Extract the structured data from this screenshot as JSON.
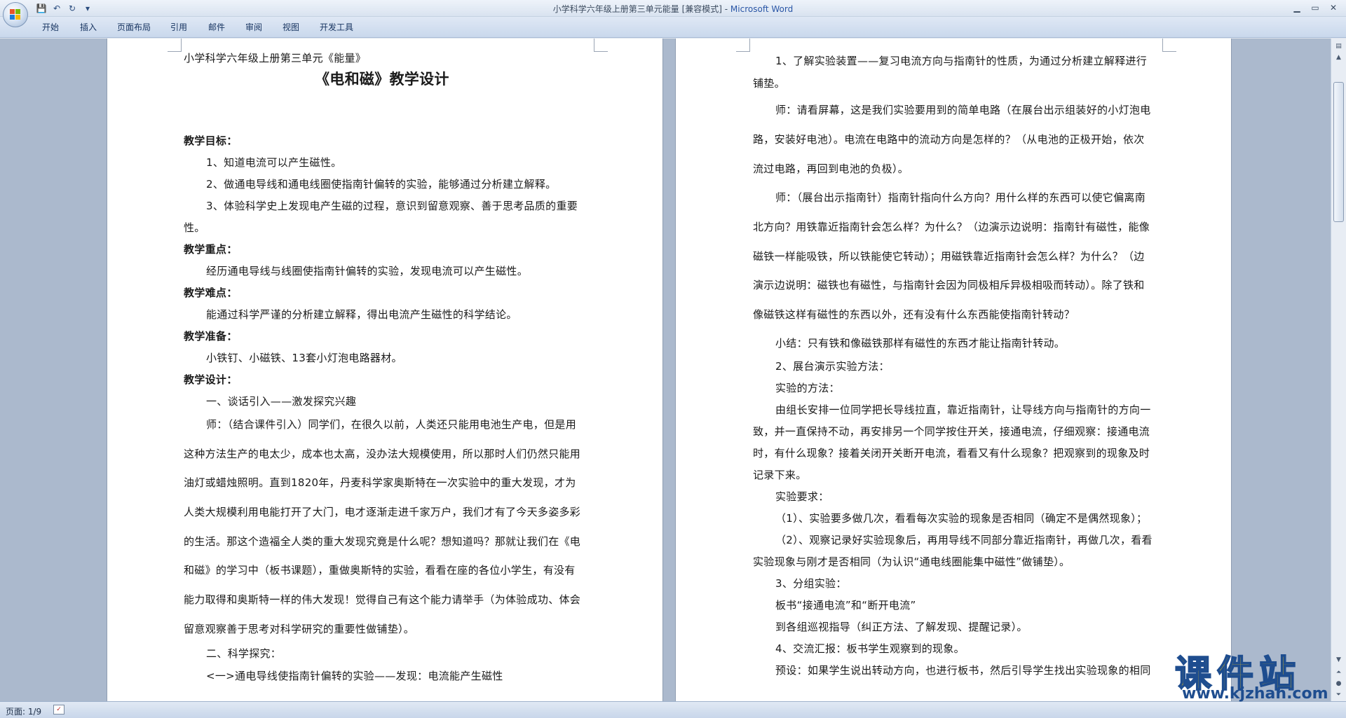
{
  "window": {
    "title": "小学科学六年级上册第三单元能量 [兼容模式] - ",
    "app_name": "Microsoft Word",
    "controls": [
      "▁",
      "▭",
      "✕"
    ]
  },
  "quick_access": {
    "save_icon": "floppy-disk-icon",
    "undo_icon": "undo-icon",
    "redo_icon": "redo-icon",
    "customize_icon": "customize-arrow-icon"
  },
  "ribbon": {
    "tabs": [
      "开始",
      "插入",
      "页面布局",
      "引用",
      "邮件",
      "审阅",
      "视图",
      "开发工具"
    ]
  },
  "left_page": {
    "lines": [
      "小学科学六年级上册第三单元《能量》",
      "《电和磁》教学设计",
      "",
      "",
      "教学目标：",
      "1、知道电流可以产生磁性。",
      "2、做通电导线和通电线圈使指南针偏转的实验，能够通过分析建立解释。",
      "3、体验科学史上发现电产生磁的过程，意识到留意观察、善于思考品质的重要",
      "性。",
      "教学重点：",
      "经历通电导线与线圈使指南针偏转的实验，发现电流可以产生磁性。",
      "教学难点：",
      "能通过科学严谨的分析建立解释，得出电流产生磁性的科学结论。",
      "教学准备：",
      "小铁钉、小磁铁、13套小灯泡电路器材。",
      "教学设计：",
      "一、谈话引入——激发探究兴趣",
      "师：（结合课件引入）同学们，在很久以前，人类还只能用电池生产电，但是用",
      "这种方法生产的电太少，成本也太高，没办法大规模使用，所以那时人们仍然只能用",
      "油灯或蜡烛照明。直到1820年，丹麦科学家奥斯特在一次实验中的重大发现，才为",
      "人类大规模利用电能打开了大门，电才逐渐走进千家万户，我们才有了今天多姿多彩",
      "的生活。那这个造福全人类的重大发现究竟是什么呢？想知道吗？那就让我们在《电",
      "和磁》的学习中（板书课题），重做奥斯特的实验，看看在座的各位小学生，有没有",
      "能力取得和奥斯特一样的伟大发现！觉得自己有这个能力请举手（为体验成功、体会",
      "留意观察善于思考对科学研究的重要性做铺垫）。",
      "二、科学探究：",
      "<一>通电导线使指南针偏转的实验——发现：电流能产生磁性"
    ]
  },
  "right_page": {
    "lines": [
      "1、了解实验装置——复习电流方向与指南针的性质，为通过分析建立解释进行",
      "铺垫。",
      "师：请看屏幕，这是我们实验要用到的简单电路（在展台出示组装好的小灯泡电",
      "路，安装好电池）。电流在电路中的流动方向是怎样的？（从电池的正极开始，依次",
      "流过电路，再回到电池的负极）。",
      "师：（展台出示指南针）指南针指向什么方向？用什么样的东西可以使它偏离南",
      "北方向？用铁靠近指南针会怎么样？为什么？（边演示边说明：指南针有磁性，能像",
      "磁铁一样能吸铁，所以铁能使它转动）；用磁铁靠近指南针会怎么样？为什么？（边",
      "演示边说明：磁铁也有磁性，与指南针会因为同极相斥异极相吸而转动）。除了铁和",
      "像磁铁这样有磁性的东西以外，还有没有什么东西能使指南针转动？",
      "小结：只有铁和像磁铁那样有磁性的东西才能让指南针转动。",
      "2、展台演示实验方法：",
      "实验的方法：",
      "由组长安排一位同学把长导线拉直，靠近指南针，让导线方向与指南针的方向一",
      "致，并一直保持不动，再安排另一个同学按住开关，接通电流，仔细观察：接通电流",
      "时，有什么现象？接着关闭开关断开电流，看看又有什么现象？把观察到的现象及时",
      "记录下来。",
      "实验要求：",
      "（1）、实验要多做几次，看看每次实验的现象是否相同（确定不是偶然现象）；",
      "（2）、观察记录好实验现象后，再用导线不同部分靠近指南针，再做几次，看看",
      "实验现象与刚才是否相同（为认识“通电线圈能集中磁性”做铺垫）。",
      "3、分组实验：",
      "板书“接通电流”和“断开电流”",
      "到各组巡视指导（纠正方法、了解发现、提醒记录）。",
      "4、交流汇报：板书学生观察到的现象。",
      "预设：如果学生说出转动方向，也进行板书，然后引导学生找出实验现象的相同"
    ]
  },
  "status": {
    "page_info": "页面: 1/9"
  },
  "watermark": {
    "text": "课件站",
    "url": "www.kjzhan.com"
  }
}
